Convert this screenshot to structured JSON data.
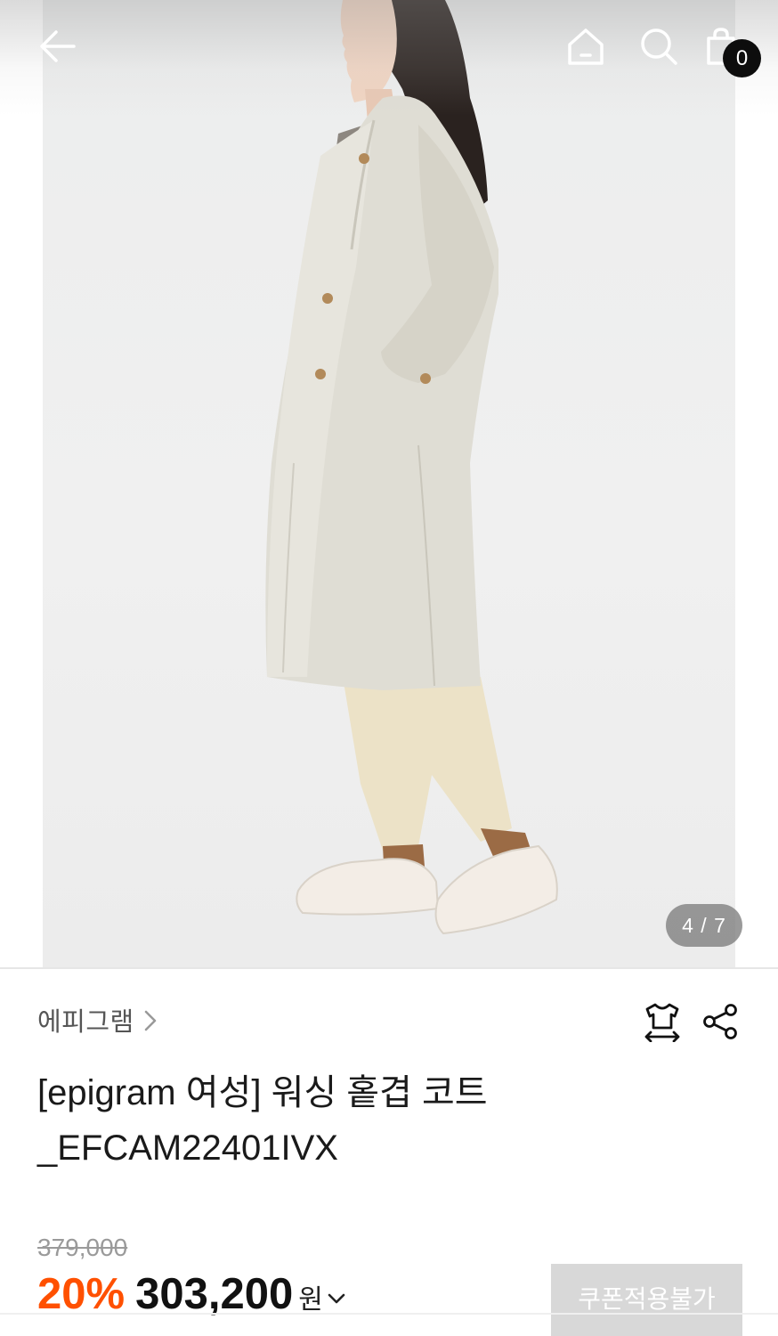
{
  "header": {
    "back_icon": "arrow-left-icon",
    "home_icon": "home-icon",
    "search_icon": "search-icon",
    "cart_icon": "shopping-bag-icon",
    "cart_count": "0"
  },
  "gallery": {
    "current": 4,
    "total": 7,
    "indicator": "4 / 7"
  },
  "product": {
    "brand": "에피그램",
    "brand_chevron_icon": "chevron-right-icon",
    "fit_icon": "size-fit-shirt-icon",
    "share_icon": "share-icon",
    "title_line1": "[epigram 여성] 워싱 홑겹 코트",
    "title_line2": "_EFCAM22401IVX",
    "original_price": "379,000",
    "discount": "20%",
    "sale_price": "303,200",
    "currency": "원",
    "price_detail_icon": "chevron-down-icon",
    "coupon_label": "쿠폰적용불가"
  },
  "colors": {
    "discount": "#ff5000",
    "badge": "#0d0d0d",
    "coupon_disabled": "#d8d8d8"
  }
}
